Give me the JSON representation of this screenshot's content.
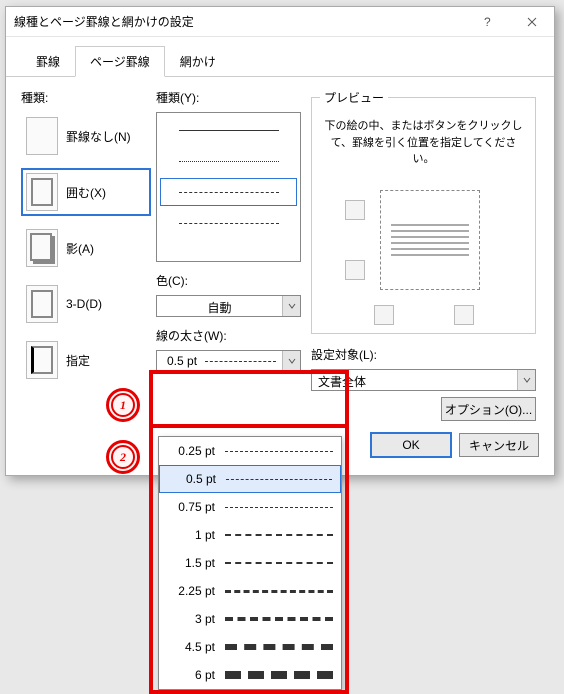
{
  "title": "線種とページ罫線と網かけの設定",
  "tabs": {
    "t1": "罫線",
    "t2": "ページ罫線",
    "t3": "網かけ"
  },
  "col1": {
    "label": "種類:",
    "none": "罫線なし(N)",
    "box": "囲む(X)",
    "shadow": "影(A)",
    "threed": "3-D(D)",
    "custom": "指定"
  },
  "col2": {
    "style_label": "種類(Y):",
    "color_label": "色(C):",
    "color_value": "自動",
    "width_label": "線の太さ(W):",
    "width_value": "0.5 pt"
  },
  "preview": {
    "legend": "プレビュー",
    "hint": "下の絵の中、またはボタンをクリックして、罫線を引く位置を指定してください。",
    "target_label": "設定対象(L):",
    "target_value": "文書全体",
    "options": "オプション(O)..."
  },
  "buttons": {
    "ok": "OK",
    "cancel": "キャンセル"
  },
  "width_options": {
    "o1": "0.25 pt",
    "o2": "0.5 pt",
    "o3": "0.75 pt",
    "o4": "1 pt",
    "o5": "1.5 pt",
    "o6": "2.25 pt",
    "o7": "3 pt",
    "o8": "4.5 pt",
    "o9": "6 pt"
  },
  "markers": {
    "m1": "1",
    "m2": "2"
  }
}
